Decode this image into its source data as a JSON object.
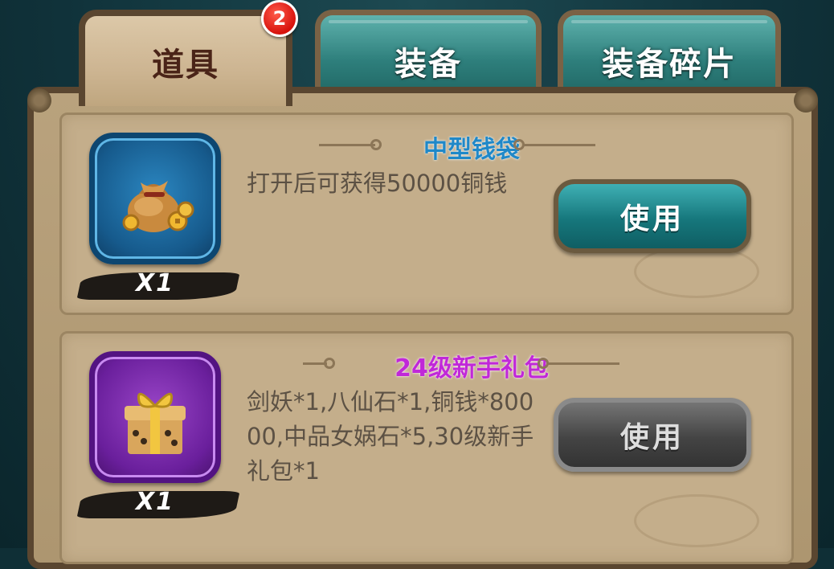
{
  "tabs": {
    "items": "道具",
    "equipment": "装备",
    "equipment_fragments": "装备碎片",
    "items_badge": "2"
  },
  "inventory": [
    {
      "name": "中型钱袋",
      "name_color": "#1f88c8",
      "icon": "money-bag-icon",
      "frame_color": "#165a8c",
      "quantity": "X1",
      "description": "打开后可获得50000铜钱",
      "button_label": "使用",
      "button_state": "enabled"
    },
    {
      "name": "24级新手礼包",
      "name_color": "#c028d8",
      "icon": "gift-box-icon",
      "frame_color": "#6a1f9c",
      "quantity": "X1",
      "description": "剑妖*1,八仙石*1,铜钱*80000,中品女娲石*5,30级新手礼包*1",
      "button_label": "使用",
      "button_state": "disabled"
    }
  ]
}
